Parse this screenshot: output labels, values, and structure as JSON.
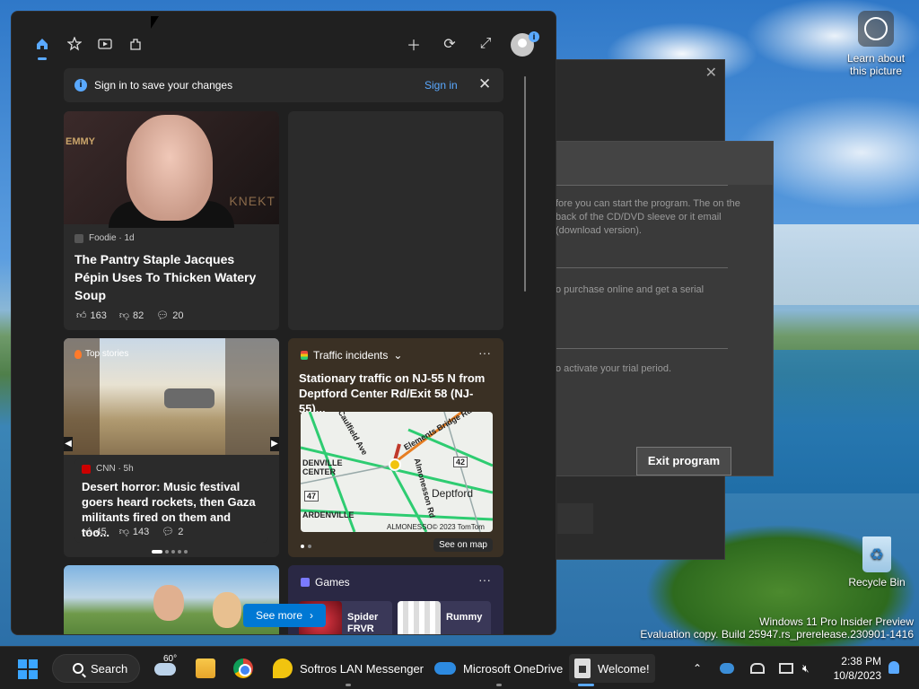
{
  "desktop": {
    "learn_label": "Learn about this picture",
    "recycle_label": "Recycle Bin",
    "watermark_line1": "Windows 11 Pro Insider Preview",
    "watermark_line2": "Evaluation copy. Build 25947.rs_prerelease.230901-1416"
  },
  "background_dialog": {
    "text1": "fore you can start the program. The on the back of the CD/DVD sleeve or it email (download version).",
    "text2": "o purchase online and get a serial",
    "text3": "o activate your trial period.",
    "exit_button": "Exit program"
  },
  "widgets": {
    "icons": {
      "home": "home-icon",
      "favorites": "star-add-icon",
      "video": "play-icon",
      "family": "puzzle-icon",
      "add": "plus-icon",
      "refresh": "refresh-icon",
      "expand": "expand-icon"
    },
    "avatar_badge": "i",
    "signin_bar": {
      "message": "Sign in to save your changes",
      "link": "Sign in"
    },
    "card1": {
      "emmy": "EMMY",
      "knekt": "KNEKT",
      "source": "Foodie · 1d",
      "headline": "The Pantry Staple Jacques Pépin Uses To Thicken Watery Soup",
      "likes": "163",
      "dislikes": "82",
      "comments": "20"
    },
    "card3": {
      "section": "Top stories",
      "source": "CNN · 5h",
      "headline": "Desert horror: Music festival goers heard rockets, then Gaza militants fired on them and too...",
      "likes": "45",
      "dislikes": "143",
      "comments": "2"
    },
    "card4": {
      "section": "Traffic incidents",
      "headline": "Stationary traffic on NJ-55 N from Deptford Center Rd/Exit 58 (NJ-55)...",
      "map_labels": {
        "caulfield": "Caulfield Ave",
        "denville": "DENVILLE CENTER",
        "ardenville": "ARDENVILLE",
        "elements": "Elements Bridge Rd",
        "almonesson": "Almonesson Rd",
        "deptford": "Deptford",
        "route42": "42",
        "route47": "47",
        "copyright": "ALMONESSO© 2023 TomTom"
      },
      "see_on_map": "See on map"
    },
    "card6": {
      "section": "Games",
      "game1": "Spider FRVR",
      "game2": "Rummy"
    },
    "see_more": "See more"
  },
  "taskbar": {
    "search": "Search",
    "weather_temp": "60°",
    "apps": {
      "lan": "Softros LAN Messenger",
      "onedrive": "Microsoft OneDrive",
      "welcome": "Welcome!"
    },
    "time": "2:38 PM",
    "date": "10/8/2023"
  }
}
